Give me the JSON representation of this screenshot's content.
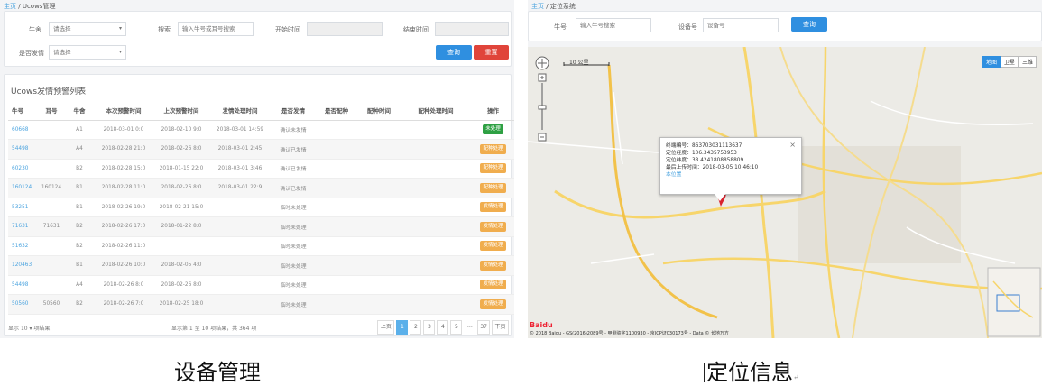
{
  "left": {
    "breadcrumb": {
      "home": "主页",
      "sep": "/",
      "current": "Ucows管理"
    },
    "filters": {
      "cow_label": "牛舍",
      "cow_value": "请选择",
      "search_label": "搜索",
      "search_placeholder": "输入牛号或耳号搜索",
      "start_label": "开始时间",
      "end_label": "结束时间",
      "estrus_label": "是否发情",
      "estrus_value": "请选择",
      "query_button": "查询",
      "reset_button": "重置"
    },
    "table_title": "Ucows发情预警列表",
    "columns": [
      "牛号",
      "耳号",
      "牛舍",
      "本次预警时间",
      "上次预警时间",
      "发情处理时间",
      "是否发情",
      "是否配种",
      "配种时间",
      "配种处理时间",
      "操作"
    ],
    "rows": [
      {
        "cow": "60668",
        "ear": "",
        "barn": "A1",
        "this": "2018-03-01 0:0",
        "last": "2018-02-10 9:0",
        "handle": "2018-03-01 14:59",
        "estrus": "确认未发情",
        "bred": "",
        "btime": "",
        "bhandle": "",
        "op": "未处理",
        "op_color": "green"
      },
      {
        "cow": "54498",
        "ear": "",
        "barn": "A4",
        "this": "2018-02-28 21:0",
        "last": "2018-02-26 8:0",
        "handle": "2018-03-01 2:45",
        "estrus": "确认已发情",
        "bred": "",
        "btime": "",
        "bhandle": "",
        "op": "配种处理",
        "op_color": "orange"
      },
      {
        "cow": "60230",
        "ear": "",
        "barn": "B2",
        "this": "2018-02-28 15:0",
        "last": "2018-01-15 22:0",
        "handle": "2018-03-01 3:46",
        "estrus": "确认已发情",
        "bred": "",
        "btime": "",
        "bhandle": "",
        "op": "配种处理",
        "op_color": "orange"
      },
      {
        "cow": "160124",
        "ear": "160124",
        "barn": "B1",
        "this": "2018-02-28 11:0",
        "last": "2018-02-26 8:0",
        "handle": "2018-03-01 22:9",
        "estrus": "确认已发情",
        "bred": "",
        "btime": "",
        "bhandle": "",
        "op": "配种处理",
        "op_color": "orange"
      },
      {
        "cow": "53251",
        "ear": "",
        "barn": "B1",
        "this": "2018-02-26 19:0",
        "last": "2018-02-21 15:0",
        "handle": "",
        "estrus": "临时未处理",
        "bred": "",
        "btime": "",
        "bhandle": "",
        "op": "发情处理",
        "op_color": "orange"
      },
      {
        "cow": "71631",
        "ear": "71631",
        "barn": "B2",
        "this": "2018-02-26 17:0",
        "last": "2018-01-22 8:0",
        "handle": "",
        "estrus": "临时未处理",
        "bred": "",
        "btime": "",
        "bhandle": "",
        "op": "发情处理",
        "op_color": "orange"
      },
      {
        "cow": "51632",
        "ear": "",
        "barn": "B2",
        "this": "2018-02-26 11:0",
        "last": "",
        "handle": "",
        "estrus": "临时未处理",
        "bred": "",
        "btime": "",
        "bhandle": "",
        "op": "发情处理",
        "op_color": "orange"
      },
      {
        "cow": "120463",
        "ear": "",
        "barn": "B1",
        "this": "2018-02-26 10:0",
        "last": "2018-02-05 4:0",
        "handle": "",
        "estrus": "临时未处理",
        "bred": "",
        "btime": "",
        "bhandle": "",
        "op": "发情处理",
        "op_color": "orange"
      },
      {
        "cow": "54498",
        "ear": "",
        "barn": "A4",
        "this": "2018-02-26 8:0",
        "last": "2018-02-26 8:0",
        "handle": "",
        "estrus": "临时未处理",
        "bred": "",
        "btime": "",
        "bhandle": "",
        "op": "发情处理",
        "op_color": "orange"
      },
      {
        "cow": "50560",
        "ear": "50560",
        "barn": "B2",
        "this": "2018-02-26 7:0",
        "last": "2018-02-25 18:0",
        "handle": "",
        "estrus": "临时未处理",
        "bred": "",
        "btime": "",
        "bhandle": "",
        "op": "发情处理",
        "op_color": "orange"
      }
    ],
    "pagination": {
      "show_label": "显示",
      "page_size": "10",
      "suffix": "项结果",
      "info": "显示第 1 至 10 项结果，共 364 项",
      "prev": "上页",
      "pages": [
        "1",
        "2",
        "3",
        "4",
        "5",
        "…",
        "37"
      ],
      "next": "下页"
    }
  },
  "right": {
    "breadcrumb": {
      "home": "主页",
      "sep": "/",
      "current": "定位系统"
    },
    "filters": {
      "cow_label": "牛号",
      "cow_placeholder": "输入牛号搜索",
      "device_label": "设备号",
      "device_placeholder": "设备号",
      "query_button": "查询"
    },
    "map": {
      "scale": "10 公里",
      "type_buttons": [
        "地图",
        "卫星",
        "三维"
      ],
      "popup": {
        "device": "终端编号：863703031113637",
        "lng": "定位经度：106.3435753953",
        "lat": "定位纬度：38.4241808858809",
        "time": "最后上传时间：2018-03-05 10:46:10",
        "link": "本位置"
      },
      "logo": "Baidu",
      "copyright": "© 2018 Baidu - GS(2016)2089号 - 甲测资字1100930 - 京ICP证030173号 - Data © 长地万方"
    }
  },
  "captions": {
    "left": "设备管理",
    "right": "定位信息",
    "right_mark": "↵"
  }
}
